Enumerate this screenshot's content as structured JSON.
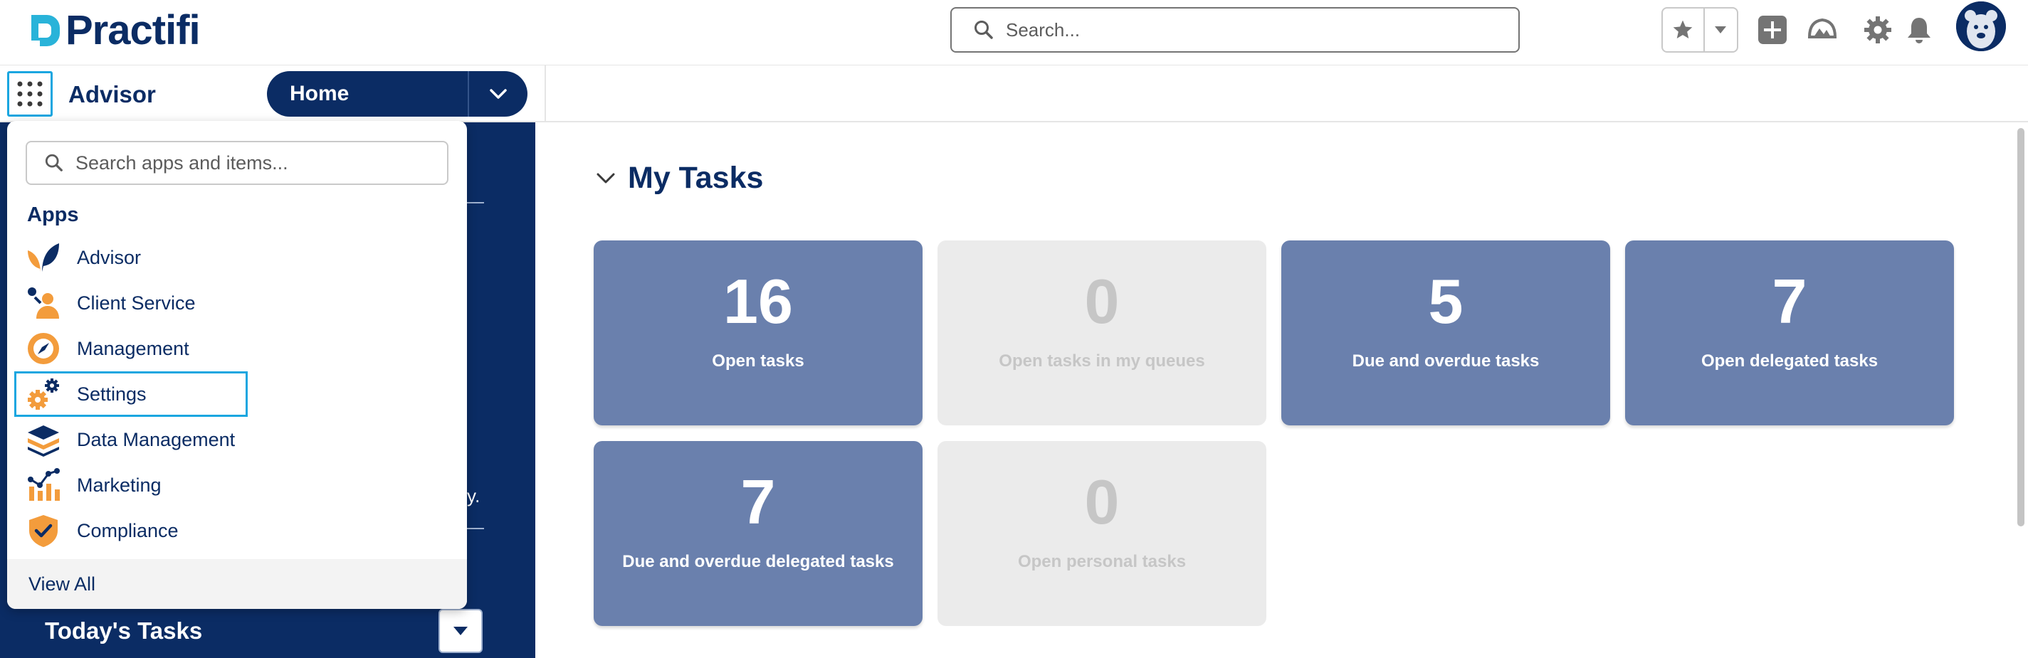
{
  "header": {
    "brand": "Practifi",
    "search_placeholder": "Search..."
  },
  "nav": {
    "app_name": "Advisor",
    "active_tab": "Home"
  },
  "launcher": {
    "search_placeholder": "Search apps and items...",
    "apps_heading": "Apps",
    "apps": [
      {
        "label": "Advisor",
        "icon": "advisor-leaf-icon"
      },
      {
        "label": "Client Service",
        "icon": "client-service-person-icon"
      },
      {
        "label": "Management",
        "icon": "management-compass-icon"
      },
      {
        "label": "Settings",
        "icon": "settings-gears-icon",
        "selected": true
      },
      {
        "label": "Data Management",
        "icon": "data-layers-icon"
      },
      {
        "label": "Marketing",
        "icon": "marketing-chart-icon"
      },
      {
        "label": "Compliance",
        "icon": "compliance-shield-icon"
      }
    ],
    "view_all": "View All"
  },
  "left_panel": {
    "text_fragment": "y.",
    "todays_tasks": "Today's Tasks"
  },
  "main": {
    "section_title": "My Tasks",
    "tiles": [
      {
        "count": "16",
        "label": "Open tasks",
        "active": true
      },
      {
        "count": "0",
        "label": "Open tasks in my queues",
        "active": false
      },
      {
        "count": "5",
        "label": "Due and overdue tasks",
        "active": true
      },
      {
        "count": "7",
        "label": "Open delegated tasks",
        "active": true
      },
      {
        "count": "7",
        "label": "Due and overdue delegated tasks",
        "active": true
      },
      {
        "count": "0",
        "label": "Open personal tasks",
        "active": false
      }
    ]
  },
  "colors": {
    "brand_navy": "#0b2c64",
    "tile_active": "#6a80ad",
    "tile_muted": "#ebebeb",
    "focus_blue": "#1aa6e0",
    "icon_orange": "#f39c3c"
  }
}
